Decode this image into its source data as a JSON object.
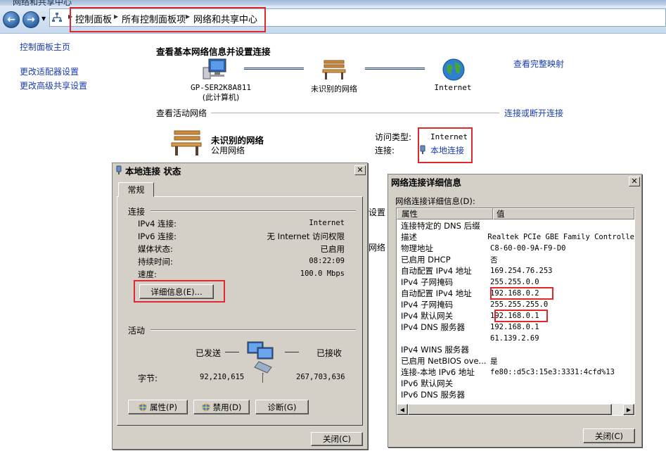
{
  "window": {
    "title": "网络和共享中心"
  },
  "navbar": {
    "back_icon": "back-arrow-icon",
    "forward_icon": "forward-arrow-icon",
    "breadcrumbs": [
      "控制面板",
      "所有控制面板项",
      "网络和共享中心"
    ]
  },
  "sidebar": {
    "items": [
      {
        "label": "控制面板主页"
      },
      {
        "label": "更改适配器设置"
      },
      {
        "label": "更改高级共享设置"
      }
    ]
  },
  "main": {
    "heading": "查看基本网络信息并设置连接",
    "view_full_map": "查看完整映射",
    "map": {
      "computer_name": "GP-SER2K8A811",
      "computer_sub": "(此计算机)",
      "network_label": "未识别的网络",
      "internet_label": "Internet"
    },
    "active_networks_label": "查看活动网络",
    "connect_disconnect": "连接或断开连接",
    "network_name": "未识别的网络",
    "network_type": "公用网络",
    "access_type_label": "访问类型:",
    "access_type_value": "Internet",
    "connection_label": "连接:",
    "connection_value": "本地连接",
    "partial_text_1": "设置",
    "partial_text_2": "网络"
  },
  "status_dialog": {
    "title": "本地连接 状态",
    "tab": "常规",
    "connection_section": "连接",
    "rows": [
      {
        "label": "IPv4 连接:",
        "value": "Internet"
      },
      {
        "label": "IPv6 连接:",
        "value": "无 Internet 访问权限"
      },
      {
        "label": "媒体状态:",
        "value": "已启用"
      },
      {
        "label": "持续时间:",
        "value": "08:22:09"
      },
      {
        "label": "速度:",
        "value": "100.0 Mbps"
      }
    ],
    "details_button": "详细信息(E)...",
    "activity_section": "活动",
    "sent_label": "已发送",
    "received_label": "已接收",
    "bytes_label": "字节:",
    "bytes_sent": "92,210,615",
    "bytes_received": "267,703,636",
    "properties_button": "属性(P)",
    "disable_button": "禁用(D)",
    "diagnose_button": "诊断(G)",
    "close_button": "关闭(C)"
  },
  "details_dialog": {
    "title": "网络连接详细信息",
    "list_label": "网络连接详细信息(D):",
    "col_property": "属性",
    "col_value": "值",
    "rows": [
      {
        "property": "连接特定的 DNS 后缀",
        "value": ""
      },
      {
        "property": "描述",
        "value": "Realtek PCIe GBE Family Controlle"
      },
      {
        "property": "物理地址",
        "value": "C8-60-00-9A-F9-D0"
      },
      {
        "property": "已启用 DHCP",
        "value": "否"
      },
      {
        "property": "自动配置 IPv4 地址",
        "value": "169.254.76.253"
      },
      {
        "property": "IPv4 子网掩码",
        "value": "255.255.0.0"
      },
      {
        "property": "自动配置 IPv4 地址",
        "value": "192.168.0.2"
      },
      {
        "property": "IPv4 子网掩码",
        "value": "255.255.255.0"
      },
      {
        "property": "IPv4 默认网关",
        "value": "192.168.0.1"
      },
      {
        "property": "IPv4 DNS 服务器",
        "value": "192.168.0.1"
      },
      {
        "property": "",
        "value": "61.139.2.69"
      },
      {
        "property": "IPv4 WINS 服务器",
        "value": ""
      },
      {
        "property": "已启用 NetBIOS ove...",
        "value": "是"
      },
      {
        "property": "连接-本地 IPv6 地址",
        "value": "fe80::d5c3:15e3:3331:4cfd%13"
      },
      {
        "property": "IPv6 默认网关",
        "value": ""
      },
      {
        "property": "IPv6 DNS 服务器",
        "value": ""
      }
    ],
    "close_button": "关闭(C)"
  },
  "colors": {
    "link": "#1a3cb0",
    "highlight_box": "#e0282e",
    "dialog_face": "#d4d0c8"
  }
}
